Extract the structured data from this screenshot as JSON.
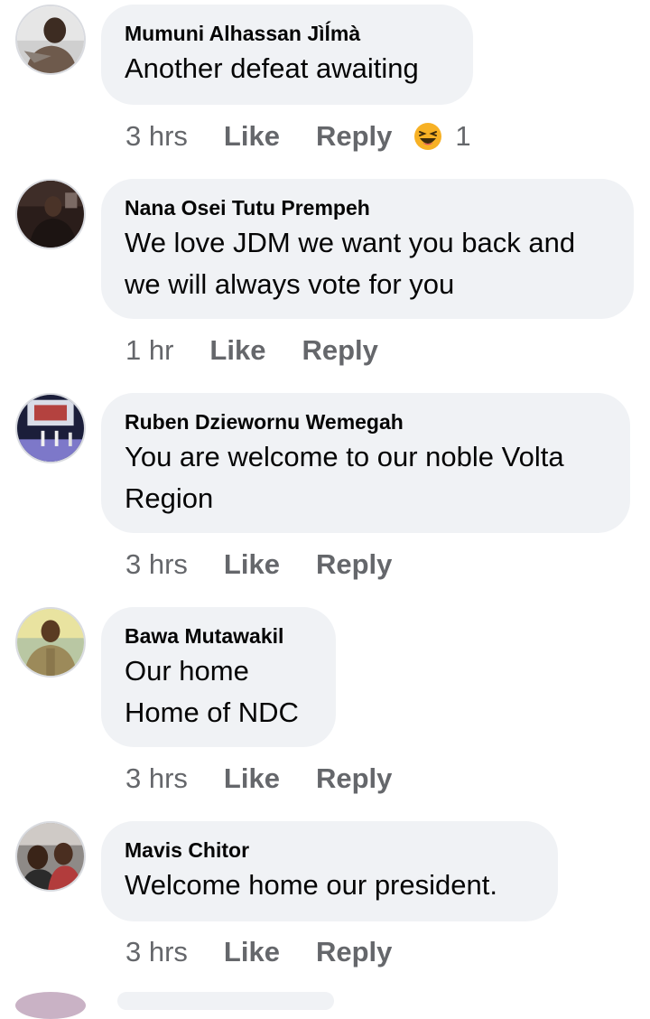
{
  "comments": [
    {
      "author": "Mumuni Alhassan Jìĺmà",
      "text": "Another defeat awaiting",
      "time": "3 hrs",
      "like": "Like",
      "reply": "Reply",
      "reaction_count": "1",
      "reaction_icon": "laughing-face-icon"
    },
    {
      "author": "Nana Osei Tutu Prempeh",
      "text": "We love JDM we want you back and we will always vote for you",
      "time": "1 hr",
      "like": "Like",
      "reply": "Reply"
    },
    {
      "author": "Ruben Dziewornu Wemegah",
      "text": "You are welcome to our noble Volta Region",
      "time": "3 hrs",
      "like": "Like",
      "reply": "Reply"
    },
    {
      "author": "Bawa Mutawakil",
      "text_line1": "Our home",
      "text_line2": "Home of NDC",
      "time": "3 hrs",
      "like": "Like",
      "reply": "Reply"
    },
    {
      "author": "Mavis Chitor",
      "text": "Welcome home our president.",
      "time": "3 hrs",
      "like": "Like",
      "reply": "Reply"
    }
  ],
  "colors": {
    "bubble": "#f0f2f5",
    "secondary_text": "#65676b",
    "primary_text": "#050505",
    "reaction_yellow": "#f7b125"
  }
}
